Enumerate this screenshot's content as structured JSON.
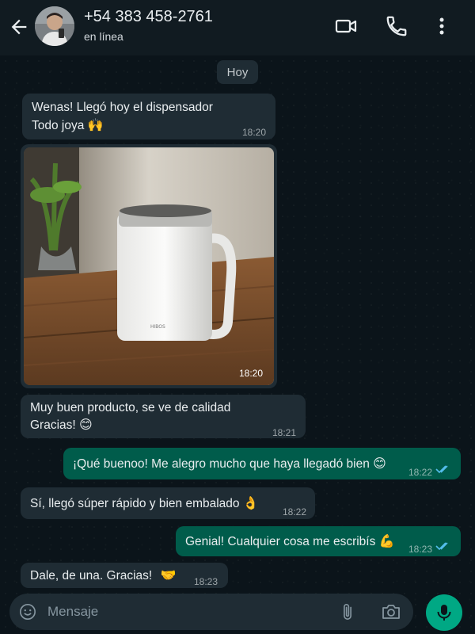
{
  "header": {
    "contact_name": "+54 383 458-2761",
    "status": "en línea",
    "icons": [
      "back-arrow-icon",
      "video-call-icon",
      "phone-call-icon",
      "more-options-icon"
    ]
  },
  "date_chip": "Hoy",
  "messages": [
    {
      "direction": "in",
      "line1": "Wenas! Llegó hoy el dispensador",
      "line2": "Todo joya",
      "emoji": "🙌",
      "time": "18:20"
    },
    {
      "direction": "in",
      "type": "image",
      "image_alt": "Taza térmica blanca sobre mesa de madera",
      "time": "18:20"
    },
    {
      "direction": "in",
      "line1": "Muy buen producto, se ve de calidad",
      "line2": "Gracias!",
      "emoji": "😊",
      "time": "18:21"
    },
    {
      "direction": "out",
      "text": "¡Qué buenoo! Me alegro mucho que haya llegadó bien",
      "emoji": "😊",
      "time": "18:22",
      "status": "read"
    },
    {
      "direction": "in",
      "text": "Sí, llegó súper rápido y bien embalado",
      "emoji": "👌",
      "time": "18:22"
    },
    {
      "direction": "out",
      "text": "Genial! Cualquier cosa me escribís",
      "emoji": "💪",
      "time": "18:23",
      "status": "read"
    },
    {
      "direction": "in",
      "text": "Dale, de una. Gracias!",
      "emoji": "🤝",
      "time": "18:23"
    }
  ],
  "input": {
    "placeholder": "Mensaje",
    "icons": [
      "emoji-icon",
      "attach-icon",
      "camera-icon",
      "mic-icon"
    ]
  },
  "colors": {
    "background": "#0b141a",
    "header": "#111b21",
    "incoming_bubble": "#1f2c34",
    "outgoing_bubble": "#005c4b",
    "accent_green": "#00a884",
    "read_ticks": "#53bdeb"
  }
}
